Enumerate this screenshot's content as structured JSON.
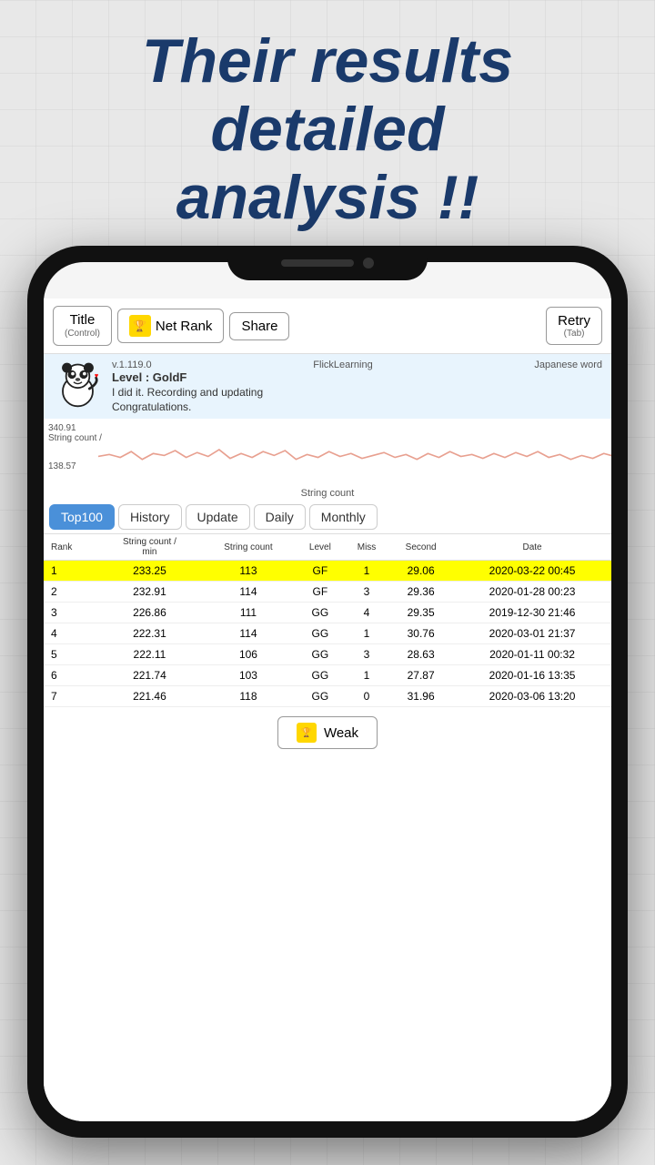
{
  "headline": {
    "line1": "Their results",
    "line2": "detailed",
    "line3": "analysis !!"
  },
  "nav": {
    "title_label": "Title",
    "title_sub": "(Control)",
    "net_rank_label": "Net Rank",
    "share_label": "Share",
    "retry_label": "Retry",
    "retry_sub": "(Tab)"
  },
  "info": {
    "version": "v.1.119.0",
    "app_name": "FlickLearning",
    "level": "Level : GoldF",
    "message": "I did it. Recording and updating",
    "congrats": "Congratulations.",
    "japanese_word": "Japanese word"
  },
  "chart": {
    "y_max": "340.91",
    "y_label": "String count /",
    "y_min": "138.57",
    "x_label": "String count"
  },
  "tabs": [
    {
      "id": "top100",
      "label": "Top100",
      "active": true
    },
    {
      "id": "history",
      "label": "History",
      "active": false
    },
    {
      "id": "update",
      "label": "Update",
      "active": false
    },
    {
      "id": "daily",
      "label": "Daily",
      "active": false
    },
    {
      "id": "monthly",
      "label": "Monthly",
      "active": false
    }
  ],
  "table": {
    "headers": [
      "Rank",
      "String count /\nmin",
      "String count",
      "Level",
      "Miss",
      "Second",
      "Date"
    ],
    "rows": [
      {
        "rank": "1",
        "string_count_min": "233.25",
        "string_count": "113",
        "level": "GF",
        "miss": "1",
        "second": "29.06",
        "date": "2020-03-22 00:45",
        "highlighted": true
      },
      {
        "rank": "2",
        "string_count_min": "232.91",
        "string_count": "114",
        "level": "GF",
        "miss": "3",
        "second": "29.36",
        "date": "2020-01-28 00:23",
        "highlighted": false
      },
      {
        "rank": "3",
        "string_count_min": "226.86",
        "string_count": "111",
        "level": "GG",
        "miss": "4",
        "second": "29.35",
        "date": "2019-12-30 21:46",
        "highlighted": false
      },
      {
        "rank": "4",
        "string_count_min": "222.31",
        "string_count": "114",
        "level": "GG",
        "miss": "1",
        "second": "30.76",
        "date": "2020-03-01 21:37",
        "highlighted": false
      },
      {
        "rank": "5",
        "string_count_min": "222.11",
        "string_count": "106",
        "level": "GG",
        "miss": "3",
        "second": "28.63",
        "date": "2020-01-11 00:32",
        "highlighted": false
      },
      {
        "rank": "6",
        "string_count_min": "221.74",
        "string_count": "103",
        "level": "GG",
        "miss": "1",
        "second": "27.87",
        "date": "2020-01-16 13:35",
        "highlighted": false
      },
      {
        "rank": "7",
        "string_count_min": "221.46",
        "string_count": "118",
        "level": "GG",
        "miss": "0",
        "second": "31.96",
        "date": "2020-03-06 13:20",
        "highlighted": false
      }
    ]
  },
  "weak_btn_label": "Weak"
}
